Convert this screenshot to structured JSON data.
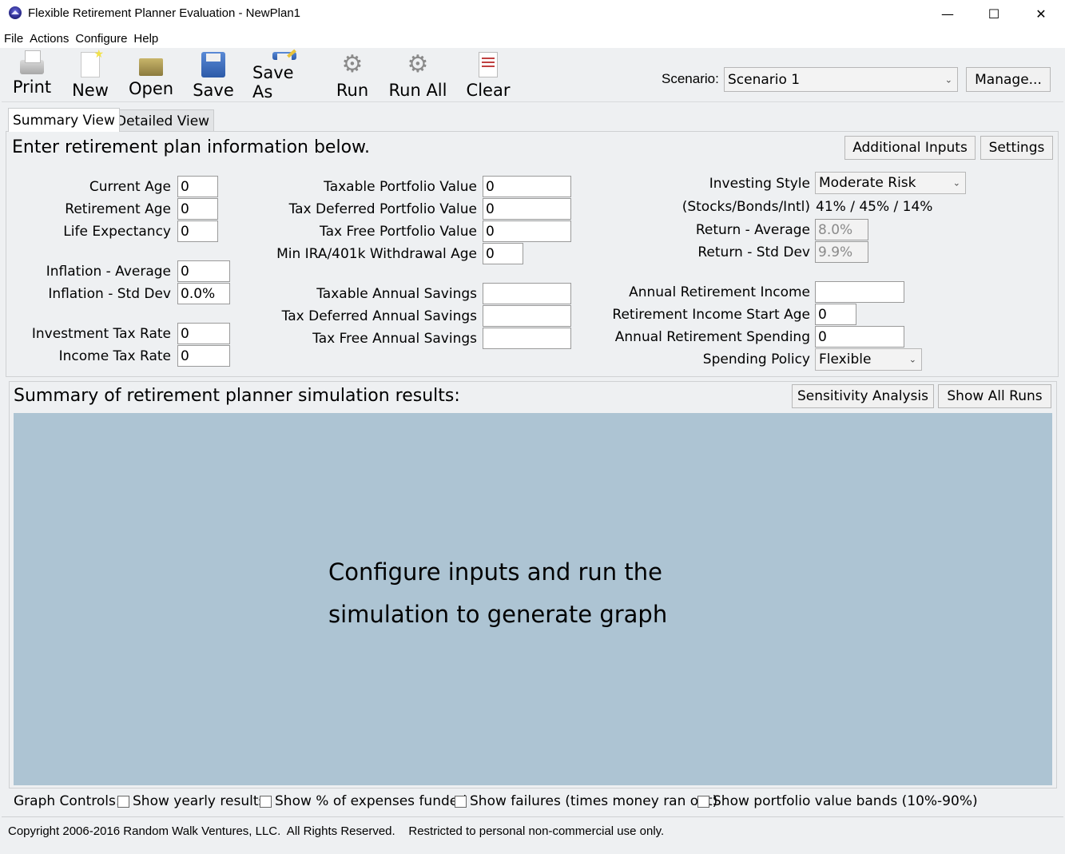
{
  "window": {
    "title": "Flexible Retirement Planner Evaluation - NewPlan1",
    "minimize": "—",
    "maximize": "☐",
    "close": "✕"
  },
  "menu": [
    "File",
    "Actions",
    "Configure",
    "Help"
  ],
  "toolbar": {
    "print": "Print",
    "new": "New",
    "open": "Open",
    "save": "Save",
    "save_as": "Save As",
    "run": "Run",
    "run_all": "Run All",
    "clear": "Clear"
  },
  "scenario": {
    "label": "Scenario:",
    "value": "Scenario 1",
    "manage": "Manage..."
  },
  "tabs": [
    "Summary View",
    "Detailed View"
  ],
  "inputs": {
    "heading": "Enter retirement plan information below.",
    "additional_inputs": "Additional Inputs",
    "settings": "Settings",
    "current_age": {
      "label": "Current Age",
      "value": "0"
    },
    "retirement_age": {
      "label": "Retirement Age",
      "value": "0"
    },
    "life_expectancy": {
      "label": "Life Expectancy",
      "value": "0"
    },
    "inflation_avg": {
      "label": "Inflation - Average",
      "value": "0"
    },
    "inflation_std": {
      "label": "Inflation - Std Dev",
      "value": "0.0%"
    },
    "investment_tax": {
      "label": "Investment Tax Rate",
      "value": "0"
    },
    "income_tax": {
      "label": "Income Tax Rate",
      "value": "0"
    },
    "taxable_portfolio": {
      "label": "Taxable Portfolio Value",
      "value": "0"
    },
    "tax_deferred_portfolio": {
      "label": "Tax Deferred Portfolio Value",
      "value": "0"
    },
    "tax_free_portfolio": {
      "label": "Tax Free Portfolio Value",
      "value": "0"
    },
    "min_ira_age": {
      "label": "Min IRA/401k Withdrawal Age",
      "value": "0"
    },
    "taxable_savings": {
      "label": "Taxable Annual Savings",
      "value": ""
    },
    "tax_deferred_savings": {
      "label": "Tax Deferred Annual Savings",
      "value": ""
    },
    "tax_free_savings": {
      "label": "Tax Free Annual Savings",
      "value": ""
    },
    "investing_style": {
      "label": "Investing Style",
      "value": "Moderate Risk"
    },
    "allocation": {
      "label": "(Stocks/Bonds/Intl)",
      "value": "41% / 45% / 14%"
    },
    "return_avg": {
      "label": "Return - Average",
      "value": "8.0%"
    },
    "return_std": {
      "label": "Return - Std Dev",
      "value": "9.9%"
    },
    "retirement_income": {
      "label": "Annual Retirement Income",
      "value": ""
    },
    "income_start_age": {
      "label": "Retirement Income Start Age",
      "value": "0"
    },
    "retirement_spending": {
      "label": "Annual Retirement Spending",
      "value": "0"
    },
    "spending_policy": {
      "label": "Spending Policy",
      "value": "Flexible"
    }
  },
  "results": {
    "heading": "Summary of retirement planner simulation results:",
    "sensitivity": "Sensitivity Analysis",
    "show_all_runs": "Show All Runs",
    "message_line1": "Configure inputs and run the",
    "message_line2": "simulation to generate graph"
  },
  "graph_controls": {
    "label": "Graph Controls:",
    "yearly": "Show yearly results",
    "expenses": "Show % of expenses funded",
    "failures": "Show failures (times money ran out)",
    "bands": "Show portfolio value bands (10%-90%)"
  },
  "footer": "Copyright 2006-2016 Random Walk Ventures, LLC.  All Rights Reserved.    Restricted to personal non-commercial use only."
}
